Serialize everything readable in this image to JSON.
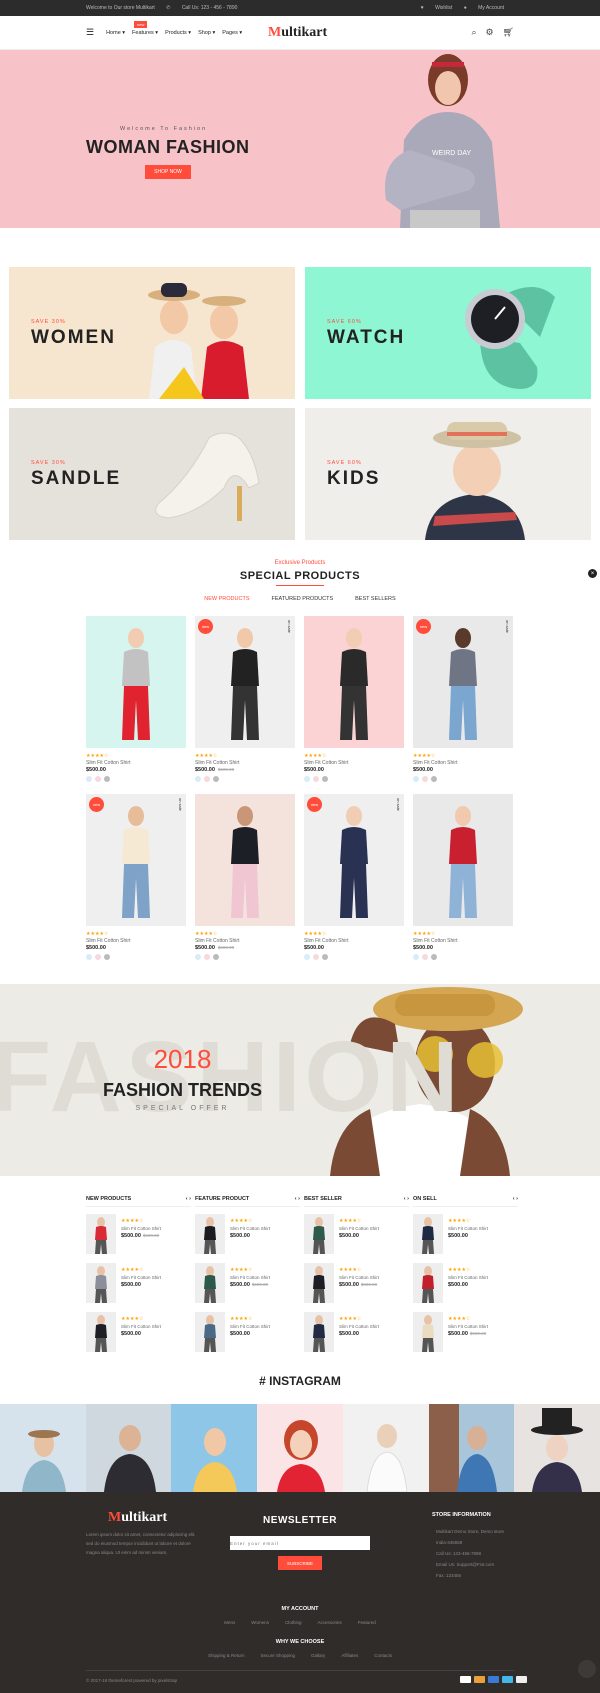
{
  "topbar": {
    "welcome": "Welcome to Our store Multikart",
    "call": "Call Us: 123 - 456 - 7890",
    "wishlist": "Wishlist",
    "account": "My Account"
  },
  "header": {
    "nav": [
      "Home",
      "Features",
      "Products",
      "Shop",
      "Pages"
    ],
    "new_badge": "new",
    "logo_letter": "M",
    "logo_rest": "ultikart"
  },
  "hero": {
    "subtitle": "Welcome To Fashion",
    "title": "WOMAN FASHION",
    "button": "SHOP NOW",
    "shirt_text": "WEIRD DAY"
  },
  "banners": [
    {
      "save": "SAVE 30%",
      "name": "WOMEN"
    },
    {
      "save": "SAVE 60%",
      "name": "WATCH"
    },
    {
      "save": "SAVE 30%",
      "name": "SANDLE"
    },
    {
      "save": "SAVE 60%",
      "name": "KIDS"
    }
  ],
  "special": {
    "subtitle": "Exclusive Products",
    "title": "SPECIAL PRODUCTS",
    "tabs": [
      "NEW PRODUCTS",
      "FEATURED PRODUCTS",
      "BEST SELLERS"
    ]
  },
  "products": [
    {
      "name": "Slim Fit Cotton Shirt",
      "price": "$500.00",
      "old": "",
      "badge": "",
      "onsale": "",
      "stars": "★★★★☆"
    },
    {
      "name": "Slim Fit Cotton Shirt",
      "price": "$500.00",
      "old": "$600.00",
      "badge": "new",
      "onsale": "on sale",
      "stars": "★★★★☆"
    },
    {
      "name": "Slim Fit Cotton Shirt",
      "price": "$500.00",
      "old": "",
      "badge": "",
      "onsale": "",
      "stars": "★★★★☆"
    },
    {
      "name": "Slim Fit Cotton Shirt",
      "price": "$500.00",
      "old": "",
      "badge": "new",
      "onsale": "on sale",
      "stars": "★★★★☆"
    },
    {
      "name": "Slim Fit Cotton Shirt",
      "price": "$500.00",
      "old": "",
      "badge": "new",
      "onsale": "on sale",
      "stars": "★★★★☆"
    },
    {
      "name": "Slim Fit Cotton Shirt",
      "price": "$500.00",
      "old": "$600.00",
      "badge": "",
      "onsale": "",
      "stars": "★★★★☆"
    },
    {
      "name": "Slim Fit Cotton Shirt",
      "price": "$500.00",
      "old": "",
      "badge": "new",
      "onsale": "on sale",
      "stars": "★★★★☆"
    },
    {
      "name": "Slim Fit Cotton Shirt",
      "price": "$500.00",
      "old": "",
      "badge": "",
      "onsale": "",
      "stars": "★★★★☆"
    }
  ],
  "promo": {
    "bg": "FASHION",
    "year": "2018",
    "title": "FASHION TRENDS",
    "sub": "SPECIAL OFFER"
  },
  "mini_cols": [
    {
      "title": "NEW PRODUCTS",
      "items": [
        {
          "name": "Slim Fit Cotton Shirt",
          "price": "$500.00",
          "old": "$600.00",
          "stars": "★★★★☆"
        },
        {
          "name": "Slim Fit Cotton Shirt",
          "price": "$500.00",
          "old": "",
          "stars": "★★★★☆"
        },
        {
          "name": "Slim Fit Cotton Shirt",
          "price": "$500.00",
          "old": "",
          "stars": "★★★★☆"
        }
      ]
    },
    {
      "title": "FEATURE PRODUCT",
      "items": [
        {
          "name": "Slim Fit Cotton Shirt",
          "price": "$500.00",
          "old": "",
          "stars": "★★★★☆"
        },
        {
          "name": "Slim Fit Cotton Shirt",
          "price": "$500.00",
          "old": "$600.00",
          "stars": "★★★★☆"
        },
        {
          "name": "Slim Fit Cotton Shirt",
          "price": "$500.00",
          "old": "",
          "stars": "★★★★☆"
        }
      ]
    },
    {
      "title": "BEST SELLER",
      "items": [
        {
          "name": "Slim Fit Cotton Shirt",
          "price": "$500.00",
          "old": "",
          "stars": "★★★★☆"
        },
        {
          "name": "Slim Fit Cotton Shirt",
          "price": "$500.00",
          "old": "$600.00",
          "stars": "★★★★☆"
        },
        {
          "name": "Slim Fit Cotton Shirt",
          "price": "$500.00",
          "old": "",
          "stars": "★★★★☆"
        }
      ]
    },
    {
      "title": "ON SELL",
      "items": [
        {
          "name": "Slim Fit Cotton Shirt",
          "price": "$500.00",
          "old": "",
          "stars": "★★★★☆"
        },
        {
          "name": "Slim Fit Cotton Shirt",
          "price": "$500.00",
          "old": "",
          "stars": "★★★★☆"
        },
        {
          "name": "Slim Fit Cotton Shirt",
          "price": "$500.00",
          "old": "$600.00",
          "stars": "★★★★☆"
        }
      ]
    }
  ],
  "instagram": {
    "title": "# INSTAGRAM"
  },
  "footer": {
    "logo_letter": "M",
    "logo_rest": "ultikart",
    "about": "Lorem ipsum dolor sit amet, consectetur adipiscing elit, sed do eiusmod tempor incididunt ut labore et dolore magna aliqua. Ut enim ad minim veniam,",
    "newsletter": "NEWSLETTER",
    "email_placeholder": "Enter your email",
    "subscribe": "SUBSCRIBE",
    "store_title": "STORE INFORMATION",
    "store_lines": [
      "Multikart Demo Store, Demo store",
      "India-345659",
      "Call Us: 123-456-7898",
      "Email Us: Support@Fiot.com",
      "Fax: 123456"
    ],
    "account_title": "MY ACCOUNT",
    "account_links": [
      "Mens",
      "Womens",
      "Clothing",
      "Accessories",
      "Featured"
    ],
    "why_title": "WHY WE CHOOSE",
    "why_links": [
      "Shipping & Return",
      "Secure Shopping",
      "Gallary",
      "Affiliates",
      "Contacts"
    ],
    "copyright": "© 2017-18 themeforest powered by pixelstrap"
  },
  "colors": {
    "accent": "#ff4c3b",
    "hero_bg": "#f7c3c8",
    "footer_bg": "#302c2a"
  }
}
